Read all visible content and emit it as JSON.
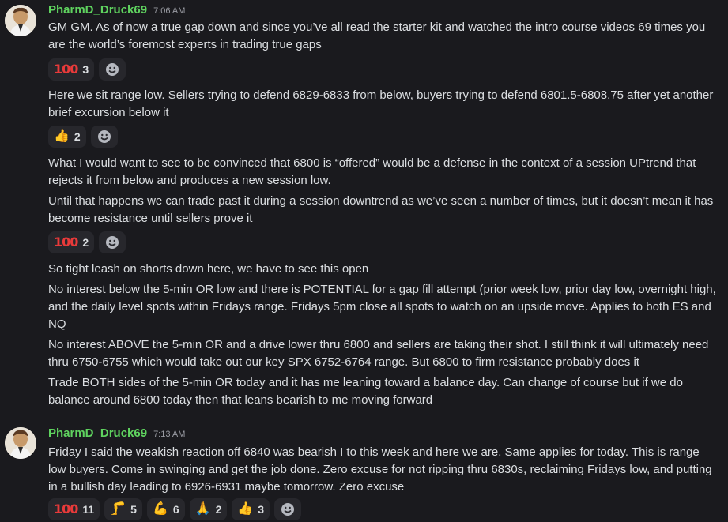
{
  "messages": [
    {
      "username": "PharmD_Druck69",
      "time": "7:06 AM",
      "lines": [
        "GM GM. As of now a true gap down and since you’ve all read the starter kit and watched the intro course videos 69 times you are the world’s foremost experts in trading true gaps",
        "Here we sit range low. Sellers trying to defend 6829-6833 from below, buyers trying to defend 6801.5-6808.75 after yet another brief excursion below it",
        "What I would want to see to be convinced that 6800 is “offered” would be a defense in the context of a session UPtrend that rejects it from below and produces a new session low.",
        "Until that happens we can trade past it during a session downtrend as we’ve seen a number of times, but it doesn’t mean it has become resistance until sellers prove it",
        "So tight leash on shorts down here, we have to see this open",
        "No interest below the 5-min OR low and there is POTENTIAL for a gap fill attempt (prior week low, prior day low, overnight high, and the daily level spots within Fridays range. Fridays 5pm close all spots to watch on an upside move. Applies to both ES and NQ",
        "No interest ABOVE the 5-min OR and a drive lower thru 6800 and sellers are taking their shot. I still think it will ultimately need thru 6750-6755  which would take out our key SPX 6752-6764 range. But 6800 to firm resistance probably does it",
        "Trade BOTH sides of the 5-min OR today and it has me leaning toward a balance day. Can change of course but if we do balance around 6800 today then that leans bearish to me moving forward"
      ],
      "reactions": [
        [
          {
            "emoji": "hundred-icon",
            "count": "3"
          }
        ],
        [
          {
            "emoji": "thumbs-up-icon",
            "count": "2"
          }
        ],
        [
          {
            "emoji": "hundred-icon",
            "count": "2"
          }
        ]
      ]
    },
    {
      "username": "PharmD_Druck69",
      "time": "7:13 AM",
      "lines": [
        "Friday I said the weakish reaction off 6840 was bearish I to this week and here we are. Same applies for today. This is range low buyers. Come in swinging and get the job done. Zero excuse for not ripping thru 6830s, reclaiming Fridays low, and putting in a bullish day leading to 6926-6931 maybe tomorrow. Zero excuse"
      ],
      "reactions": [
        [
          {
            "emoji": "hundred-icon",
            "count": "11"
          },
          {
            "emoji": "leg-icon",
            "count": "5"
          },
          {
            "emoji": "flexed-bicep-icon",
            "count": "6"
          },
          {
            "emoji": "folded-hands-icon",
            "count": "2"
          },
          {
            "emoji": "thumbs-up-icon",
            "count": "3"
          }
        ]
      ]
    }
  ],
  "glyphs": {
    "hundred": "100",
    "thumbs_up": "👍",
    "leg": "🦵",
    "bicep": "💪",
    "hands": "🙏"
  },
  "colors": {
    "background": "#1a1a1e",
    "username": "#5fd35f",
    "reaction_bg": "#27272c",
    "text": "#dbdee1"
  }
}
